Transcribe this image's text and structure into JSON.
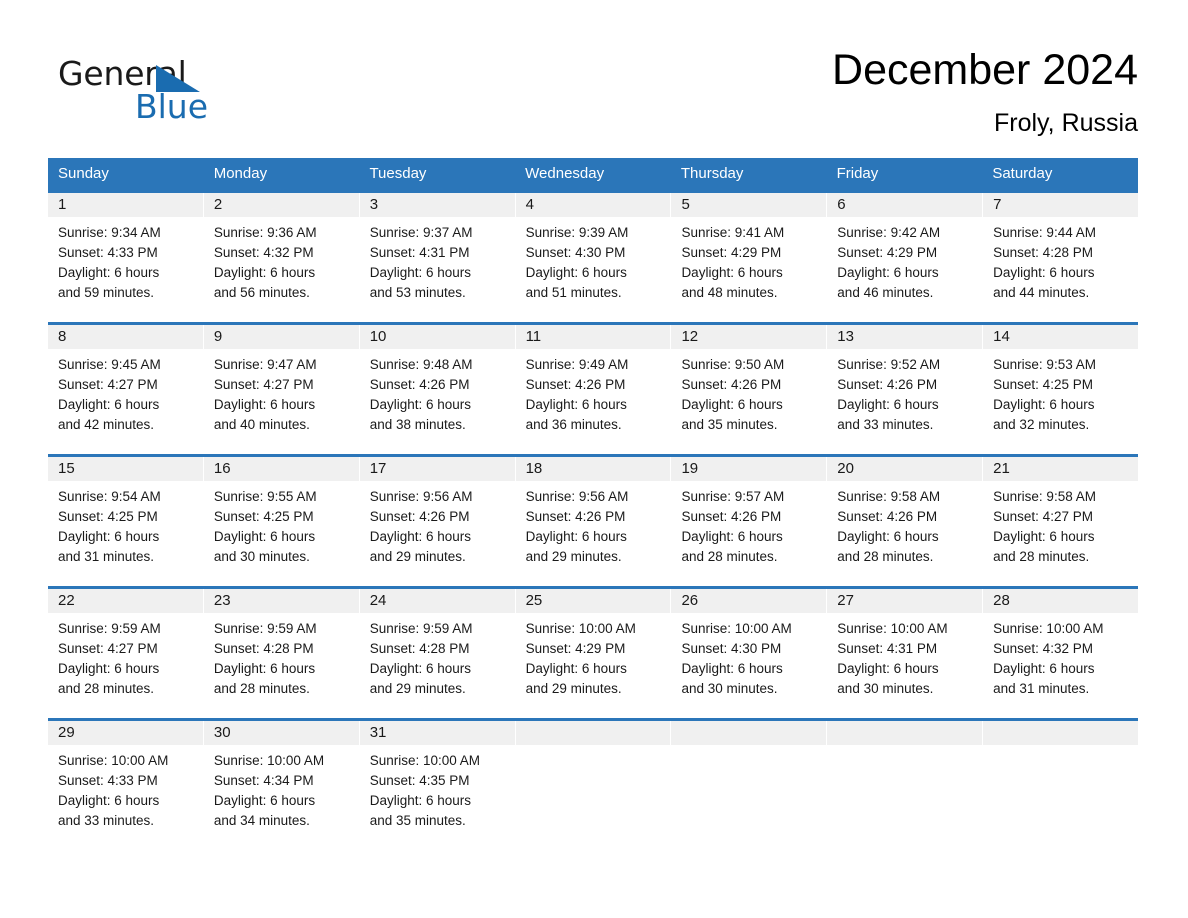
{
  "brand": {
    "name_part1": "General",
    "name_part2": "Blue",
    "accent_color": "#1a6cb0",
    "logo_icon": "triangle-flag-icon"
  },
  "header": {
    "title": "December 2024",
    "location": "Froly, Russia"
  },
  "calendar": {
    "header_bg": "#2b76b9",
    "row_divider_color": "#2b76b9",
    "datenum_bg": "#f0f0f0",
    "weekday_headers": [
      "Sunday",
      "Monday",
      "Tuesday",
      "Wednesday",
      "Thursday",
      "Friday",
      "Saturday"
    ],
    "weeks": [
      [
        {
          "day": "1",
          "sunrise": "Sunrise: 9:34 AM",
          "sunset": "Sunset: 4:33 PM",
          "daylight_line1": "Daylight: 6 hours",
          "daylight_line2": "and 59 minutes."
        },
        {
          "day": "2",
          "sunrise": "Sunrise: 9:36 AM",
          "sunset": "Sunset: 4:32 PM",
          "daylight_line1": "Daylight: 6 hours",
          "daylight_line2": "and 56 minutes."
        },
        {
          "day": "3",
          "sunrise": "Sunrise: 9:37 AM",
          "sunset": "Sunset: 4:31 PM",
          "daylight_line1": "Daylight: 6 hours",
          "daylight_line2": "and 53 minutes."
        },
        {
          "day": "4",
          "sunrise": "Sunrise: 9:39 AM",
          "sunset": "Sunset: 4:30 PM",
          "daylight_line1": "Daylight: 6 hours",
          "daylight_line2": "and 51 minutes."
        },
        {
          "day": "5",
          "sunrise": "Sunrise: 9:41 AM",
          "sunset": "Sunset: 4:29 PM",
          "daylight_line1": "Daylight: 6 hours",
          "daylight_line2": "and 48 minutes."
        },
        {
          "day": "6",
          "sunrise": "Sunrise: 9:42 AM",
          "sunset": "Sunset: 4:29 PM",
          "daylight_line1": "Daylight: 6 hours",
          "daylight_line2": "and 46 minutes."
        },
        {
          "day": "7",
          "sunrise": "Sunrise: 9:44 AM",
          "sunset": "Sunset: 4:28 PM",
          "daylight_line1": "Daylight: 6 hours",
          "daylight_line2": "and 44 minutes."
        }
      ],
      [
        {
          "day": "8",
          "sunrise": "Sunrise: 9:45 AM",
          "sunset": "Sunset: 4:27 PM",
          "daylight_line1": "Daylight: 6 hours",
          "daylight_line2": "and 42 minutes."
        },
        {
          "day": "9",
          "sunrise": "Sunrise: 9:47 AM",
          "sunset": "Sunset: 4:27 PM",
          "daylight_line1": "Daylight: 6 hours",
          "daylight_line2": "and 40 minutes."
        },
        {
          "day": "10",
          "sunrise": "Sunrise: 9:48 AM",
          "sunset": "Sunset: 4:26 PM",
          "daylight_line1": "Daylight: 6 hours",
          "daylight_line2": "and 38 minutes."
        },
        {
          "day": "11",
          "sunrise": "Sunrise: 9:49 AM",
          "sunset": "Sunset: 4:26 PM",
          "daylight_line1": "Daylight: 6 hours",
          "daylight_line2": "and 36 minutes."
        },
        {
          "day": "12",
          "sunrise": "Sunrise: 9:50 AM",
          "sunset": "Sunset: 4:26 PM",
          "daylight_line1": "Daylight: 6 hours",
          "daylight_line2": "and 35 minutes."
        },
        {
          "day": "13",
          "sunrise": "Sunrise: 9:52 AM",
          "sunset": "Sunset: 4:26 PM",
          "daylight_line1": "Daylight: 6 hours",
          "daylight_line2": "and 33 minutes."
        },
        {
          "day": "14",
          "sunrise": "Sunrise: 9:53 AM",
          "sunset": "Sunset: 4:25 PM",
          "daylight_line1": "Daylight: 6 hours",
          "daylight_line2": "and 32 minutes."
        }
      ],
      [
        {
          "day": "15",
          "sunrise": "Sunrise: 9:54 AM",
          "sunset": "Sunset: 4:25 PM",
          "daylight_line1": "Daylight: 6 hours",
          "daylight_line2": "and 31 minutes."
        },
        {
          "day": "16",
          "sunrise": "Sunrise: 9:55 AM",
          "sunset": "Sunset: 4:25 PM",
          "daylight_line1": "Daylight: 6 hours",
          "daylight_line2": "and 30 minutes."
        },
        {
          "day": "17",
          "sunrise": "Sunrise: 9:56 AM",
          "sunset": "Sunset: 4:26 PM",
          "daylight_line1": "Daylight: 6 hours",
          "daylight_line2": "and 29 minutes."
        },
        {
          "day": "18",
          "sunrise": "Sunrise: 9:56 AM",
          "sunset": "Sunset: 4:26 PM",
          "daylight_line1": "Daylight: 6 hours",
          "daylight_line2": "and 29 minutes."
        },
        {
          "day": "19",
          "sunrise": "Sunrise: 9:57 AM",
          "sunset": "Sunset: 4:26 PM",
          "daylight_line1": "Daylight: 6 hours",
          "daylight_line2": "and 28 minutes."
        },
        {
          "day": "20",
          "sunrise": "Sunrise: 9:58 AM",
          "sunset": "Sunset: 4:26 PM",
          "daylight_line1": "Daylight: 6 hours",
          "daylight_line2": "and 28 minutes."
        },
        {
          "day": "21",
          "sunrise": "Sunrise: 9:58 AM",
          "sunset": "Sunset: 4:27 PM",
          "daylight_line1": "Daylight: 6 hours",
          "daylight_line2": "and 28 minutes."
        }
      ],
      [
        {
          "day": "22",
          "sunrise": "Sunrise: 9:59 AM",
          "sunset": "Sunset: 4:27 PM",
          "daylight_line1": "Daylight: 6 hours",
          "daylight_line2": "and 28 minutes."
        },
        {
          "day": "23",
          "sunrise": "Sunrise: 9:59 AM",
          "sunset": "Sunset: 4:28 PM",
          "daylight_line1": "Daylight: 6 hours",
          "daylight_line2": "and 28 minutes."
        },
        {
          "day": "24",
          "sunrise": "Sunrise: 9:59 AM",
          "sunset": "Sunset: 4:28 PM",
          "daylight_line1": "Daylight: 6 hours",
          "daylight_line2": "and 29 minutes."
        },
        {
          "day": "25",
          "sunrise": "Sunrise: 10:00 AM",
          "sunset": "Sunset: 4:29 PM",
          "daylight_line1": "Daylight: 6 hours",
          "daylight_line2": "and 29 minutes."
        },
        {
          "day": "26",
          "sunrise": "Sunrise: 10:00 AM",
          "sunset": "Sunset: 4:30 PM",
          "daylight_line1": "Daylight: 6 hours",
          "daylight_line2": "and 30 minutes."
        },
        {
          "day": "27",
          "sunrise": "Sunrise: 10:00 AM",
          "sunset": "Sunset: 4:31 PM",
          "daylight_line1": "Daylight: 6 hours",
          "daylight_line2": "and 30 minutes."
        },
        {
          "day": "28",
          "sunrise": "Sunrise: 10:00 AM",
          "sunset": "Sunset: 4:32 PM",
          "daylight_line1": "Daylight: 6 hours",
          "daylight_line2": "and 31 minutes."
        }
      ],
      [
        {
          "day": "29",
          "sunrise": "Sunrise: 10:00 AM",
          "sunset": "Sunset: 4:33 PM",
          "daylight_line1": "Daylight: 6 hours",
          "daylight_line2": "and 33 minutes."
        },
        {
          "day": "30",
          "sunrise": "Sunrise: 10:00 AM",
          "sunset": "Sunset: 4:34 PM",
          "daylight_line1": "Daylight: 6 hours",
          "daylight_line2": "and 34 minutes."
        },
        {
          "day": "31",
          "sunrise": "Sunrise: 10:00 AM",
          "sunset": "Sunset: 4:35 PM",
          "daylight_line1": "Daylight: 6 hours",
          "daylight_line2": "and 35 minutes."
        },
        {
          "day": "",
          "sunrise": "",
          "sunset": "",
          "daylight_line1": "",
          "daylight_line2": ""
        },
        {
          "day": "",
          "sunrise": "",
          "sunset": "",
          "daylight_line1": "",
          "daylight_line2": ""
        },
        {
          "day": "",
          "sunrise": "",
          "sunset": "",
          "daylight_line1": "",
          "daylight_line2": ""
        },
        {
          "day": "",
          "sunrise": "",
          "sunset": "",
          "daylight_line1": "",
          "daylight_line2": ""
        }
      ]
    ]
  }
}
